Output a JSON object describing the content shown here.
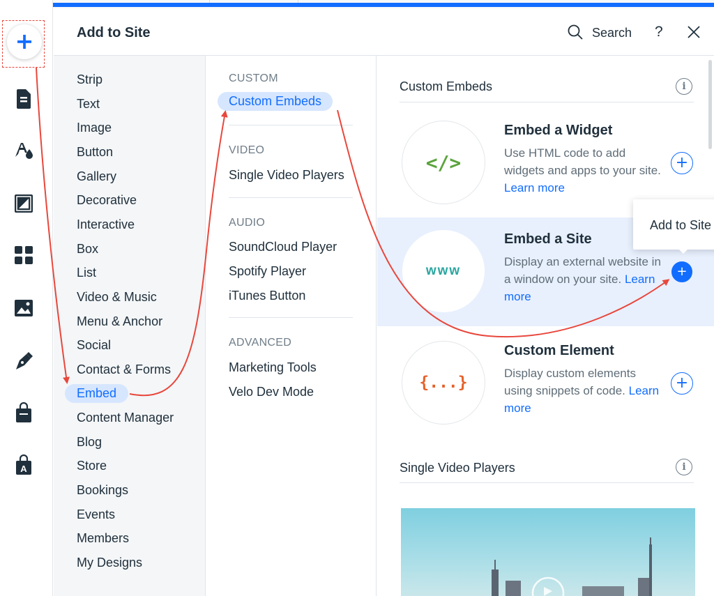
{
  "header": {
    "title": "Add to Site",
    "search_label": "Search",
    "help": "?"
  },
  "rail": {
    "items": [
      "add-icon",
      "page-icon",
      "theme-icon",
      "background-icon",
      "apps-icon",
      "media-icon",
      "blog-pen-icon",
      "store-icon",
      "market-icon"
    ]
  },
  "categories": [
    "Strip",
    "Text",
    "Image",
    "Button",
    "Gallery",
    "Decorative",
    "Interactive",
    "Box",
    "List",
    "Video & Music",
    "Menu & Anchor",
    "Social",
    "Contact & Forms",
    "Embed",
    "Content Manager",
    "Blog",
    "Store",
    "Bookings",
    "Events",
    "Members",
    "My Designs"
  ],
  "active_category": "Embed",
  "subsections": {
    "custom": {
      "heading": "CUSTOM",
      "items": [
        "Custom Embeds"
      ]
    },
    "video": {
      "heading": "VIDEO",
      "items": [
        "Single Video Players"
      ]
    },
    "audio": {
      "heading": "AUDIO",
      "items": [
        "SoundCloud Player",
        "Spotify Player",
        "iTunes Button"
      ]
    },
    "advanced": {
      "heading": "ADVANCED",
      "items": [
        "Marketing Tools",
        "Velo Dev Mode"
      ]
    }
  },
  "content": {
    "section1_title": "Custom Embeds",
    "section2_title": "Single Video Players",
    "info_glyph": "i",
    "cards": [
      {
        "thumb": "</>",
        "title": "Embed a Widget",
        "desc": "Use HTML code to add widgets and apps to your site.",
        "link": "Learn more"
      },
      {
        "thumb": "www",
        "title": "Embed a Site",
        "desc": "Display an external website in a window on your site.",
        "link": "Learn more"
      },
      {
        "thumb": "{...}",
        "title": "Custom Element",
        "desc": "Display custom elements using snippets of code.",
        "link": "Learn more"
      }
    ]
  },
  "tooltip": "Add to Site",
  "colors": {
    "accent": "#116dff",
    "annotation": "#e8473c",
    "widget_code": "#5ba33c",
    "site_www": "#2aa6a0",
    "element_code": "#e5622a"
  }
}
